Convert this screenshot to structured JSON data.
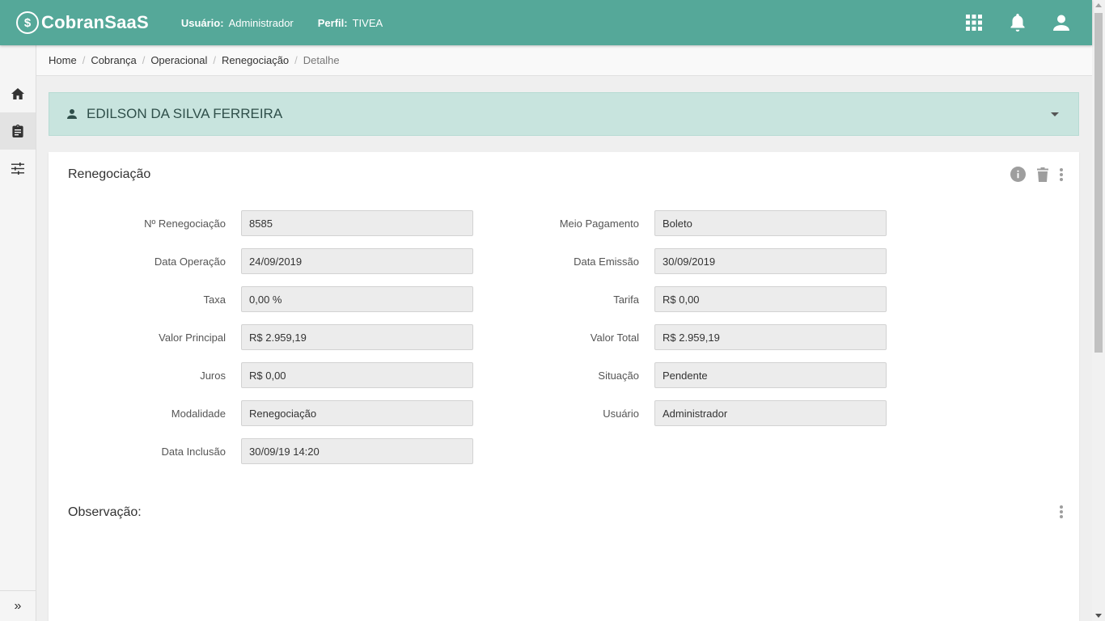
{
  "app": {
    "logo_text": "CobranSaaS",
    "user_label": "Usuário:",
    "user_value": "Administrador",
    "profile_label": "Perfil:",
    "profile_value": "TIVEA"
  },
  "topbar_icons": [
    "apps-grid-icon",
    "bell-icon",
    "user-account-icon"
  ],
  "sidebar": {
    "items": [
      {
        "icon": "home-icon"
      },
      {
        "icon": "clipboard-icon",
        "active": true
      },
      {
        "icon": "sliders-icon"
      }
    ],
    "expand_label": "»"
  },
  "breadcrumb": [
    "Home",
    "Cobrança",
    "Operacional",
    "Renegociação",
    "Detalhe"
  ],
  "client": {
    "name": "EDILSON DA SILVA FERREIRA"
  },
  "card": {
    "title": "Renegociação",
    "left_fields": [
      {
        "label": "Nº Renegociação",
        "value": "8585"
      },
      {
        "label": "Data Operação",
        "value": "24/09/2019"
      },
      {
        "label": "Taxa",
        "value": "0,00 %"
      },
      {
        "label": "Valor Principal",
        "value": "R$ 2.959,19"
      },
      {
        "label": "Juros",
        "value": "R$ 0,00"
      },
      {
        "label": "Modalidade",
        "value": "Renegociação"
      },
      {
        "label": "Data Inclusão",
        "value": "30/09/19 14:20"
      }
    ],
    "right_fields": [
      {
        "label": "Meio Pagamento",
        "value": "Boleto"
      },
      {
        "label": "Data Emissão",
        "value": "30/09/2019"
      },
      {
        "label": "Tarifa",
        "value": "R$ 0,00"
      },
      {
        "label": "Valor Total",
        "value": "R$ 2.959,19"
      },
      {
        "label": "Situação",
        "value": "Pendente"
      },
      {
        "label": "Usuário",
        "value": "Administrador"
      }
    ],
    "observation_title": "Observação:"
  },
  "colors": {
    "topbar": "#55a899",
    "client_bar": "#c8e4de"
  }
}
